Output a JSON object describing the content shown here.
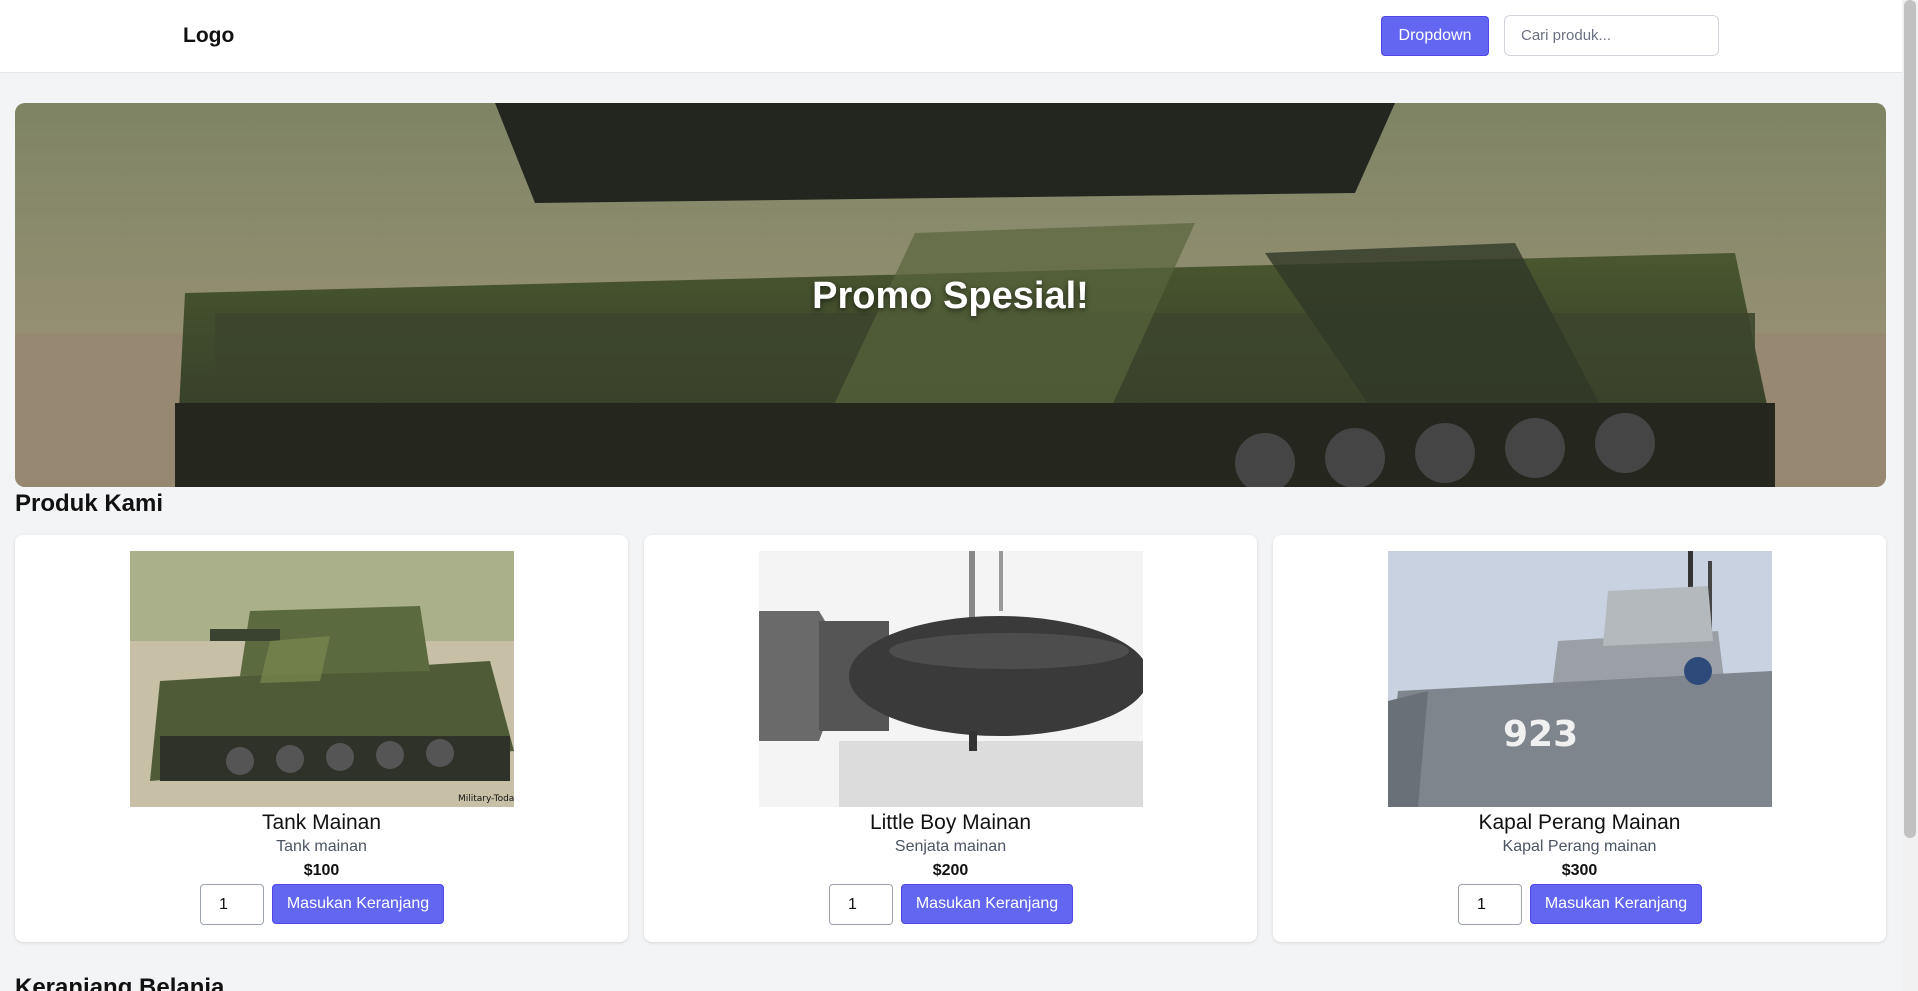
{
  "header": {
    "logo": "Logo",
    "dropdown_label": "Dropdown",
    "search_placeholder": "Cari produk..."
  },
  "hero": {
    "title": "Promo Spesial!"
  },
  "products_section": {
    "title": "Produk Kami",
    "items": [
      {
        "name": "Tank Mainan",
        "description": "Tank mainan",
        "price": "$100",
        "quantity": "1",
        "button": "Masukan Keranjang",
        "watermark": "Military-Today"
      },
      {
        "name": "Little Boy Mainan",
        "description": "Senjata mainan",
        "price": "$200",
        "quantity": "1",
        "button": "Masukan Keranjang"
      },
      {
        "name": "Kapal Perang Mainan",
        "description": "Kapal Perang mainan",
        "price": "$300",
        "quantity": "1",
        "button": "Masukan Keranjang",
        "hull_number": "923"
      }
    ]
  },
  "cart_section": {
    "title": "Keranjang Belanja"
  },
  "colors": {
    "accent": "#6366f1",
    "page_background": "#f3f4f6"
  }
}
